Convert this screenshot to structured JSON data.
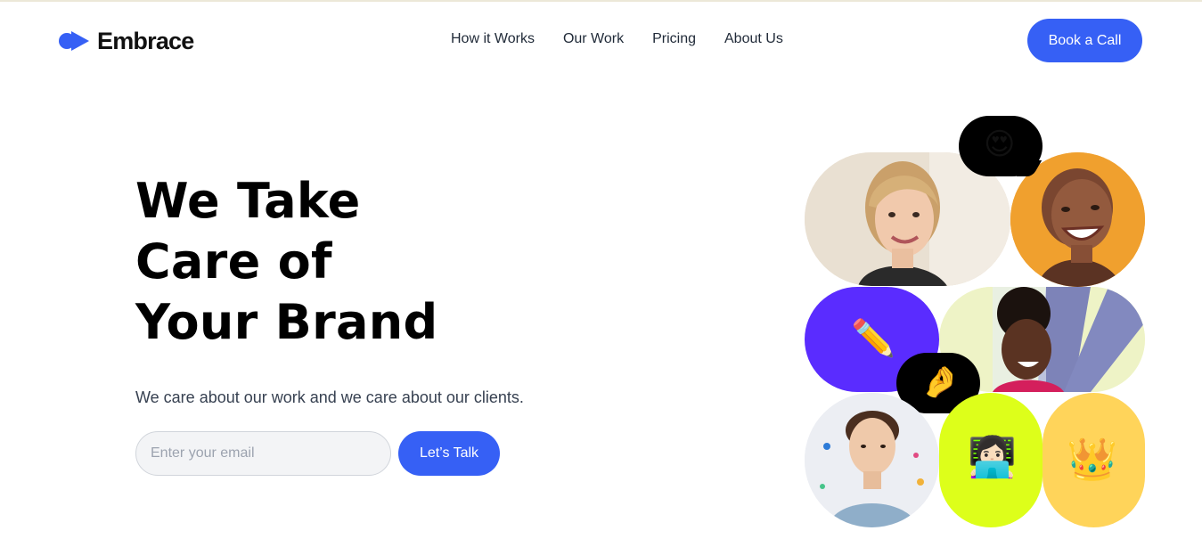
{
  "brand": {
    "name": "Embrace",
    "accent": "#3660f5"
  },
  "nav": {
    "items": [
      "How it Works",
      "Our Work",
      "Pricing",
      "About Us"
    ],
    "cta_label": "Book a Call"
  },
  "hero": {
    "title_lines": [
      "We Take",
      "Care of",
      "Your Brand"
    ],
    "subtitle": "We care about our work and we care about our clients.",
    "email_placeholder": "Enter your email",
    "submit_label": "Let’s Talk"
  },
  "collage": {
    "emojis": {
      "heart_eyes": "😍",
      "pencil": "✏️",
      "pinch": "🤌",
      "technologist": "👩🏻‍💻",
      "crown": "👑"
    },
    "colors": {
      "purple": "#5a2cff",
      "lime": "#ddff1a",
      "yellow": "#ffd45a",
      "orange": "#f0a02e",
      "beige": "#ece3d6"
    }
  }
}
